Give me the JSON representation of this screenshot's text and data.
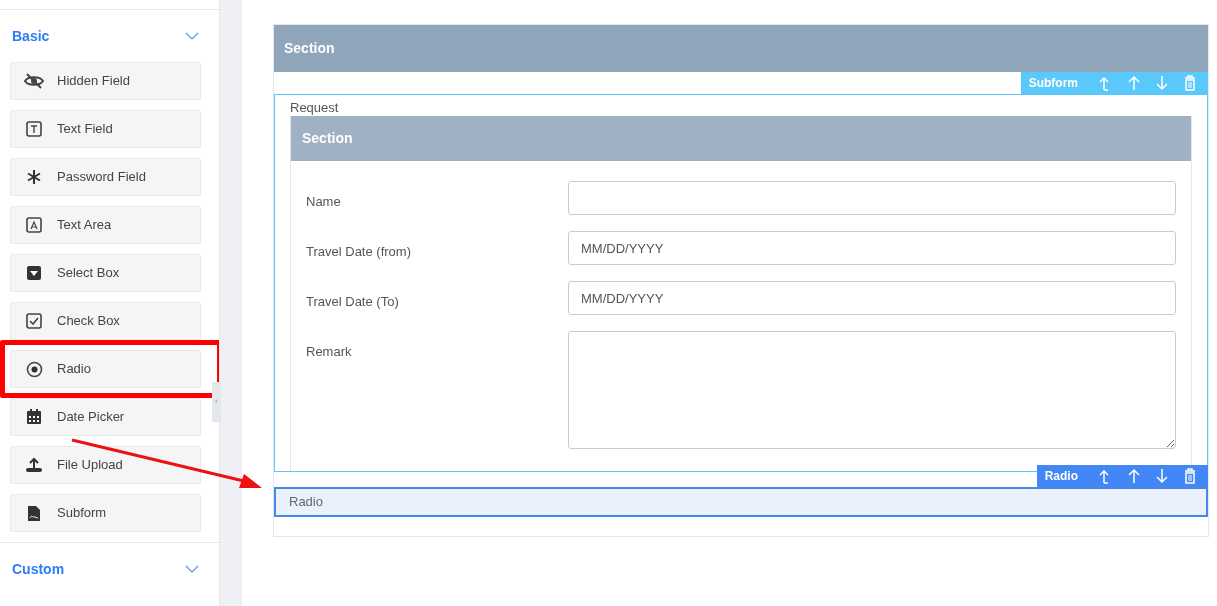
{
  "sidebar": {
    "groups": [
      {
        "title": "Basic",
        "expanded": true,
        "items": [
          {
            "label": "Hidden Field",
            "highlighted": false
          },
          {
            "label": "Text Field",
            "highlighted": false
          },
          {
            "label": "Password Field",
            "highlighted": false
          },
          {
            "label": "Text Area",
            "highlighted": false
          },
          {
            "label": "Select Box",
            "highlighted": false
          },
          {
            "label": "Check Box",
            "highlighted": false
          },
          {
            "label": "Radio",
            "highlighted": true
          },
          {
            "label": "Date Picker",
            "highlighted": false
          },
          {
            "label": "File Upload",
            "highlighted": false
          },
          {
            "label": "Subform",
            "highlighted": false
          }
        ]
      },
      {
        "title": "Custom",
        "expanded": true
      }
    ],
    "collapse_handle": "‹"
  },
  "form": {
    "section_title": "Section",
    "subform": {
      "toolbar_label": "Subform",
      "label": "Request",
      "section_title": "Section",
      "fields": [
        {
          "kind": "input",
          "label": "Name"
        },
        {
          "kind": "input",
          "label": "Travel Date (from)",
          "placeholder": "MM/DD/YYYY"
        },
        {
          "kind": "input",
          "label": "Travel Date (To)",
          "placeholder": "MM/DD/YYYY"
        },
        {
          "kind": "textarea",
          "label": "Remark"
        }
      ]
    },
    "dropped": {
      "toolbar_label": "Radio",
      "label": "Radio"
    }
  }
}
